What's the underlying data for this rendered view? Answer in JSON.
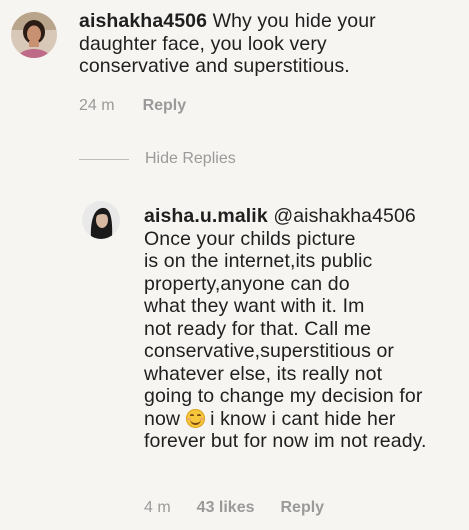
{
  "comments": [
    {
      "username": "aishakha4506",
      "lines": [
        " Why you hide your",
        "daughter face, you look very",
        "conservative and superstitious."
      ],
      "time": "24 m",
      "reply_label": "Reply"
    }
  ],
  "hide_replies_label": "Hide Replies",
  "reply": {
    "username": "aisha.u.malik",
    "mention": "@aishakha4506",
    "lines": [
      "Once your childs picture",
      "is on the internet,its public",
      "property,anyone can do",
      "what they want with it. Im",
      "not ready for that. Call me",
      "conservative,superstitious or",
      "whatever else, its really not",
      "going to change my decision for",
      "now",
      " i know i cant hide her",
      "forever but for now im not ready."
    ],
    "emoji": "smiling-face-icon",
    "time": "4 m",
    "likes": "43 likes",
    "reply_label": "Reply"
  },
  "colors": {
    "background": "#f7f5f1",
    "text": "#1f1f1f",
    "meta": "#9a9a9a"
  }
}
